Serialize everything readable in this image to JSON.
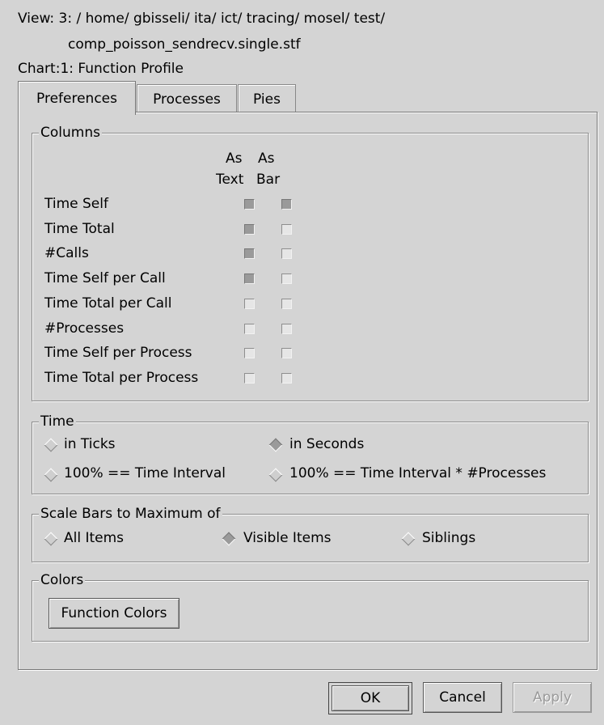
{
  "header": {
    "view_line1": "View: 3: / home/ gbisseli/ ita/ ict/ tracing/ mosel/ test/",
    "view_line2": "comp_poisson_sendrecv.single.stf",
    "chart_line": "Chart:1: Function Profile"
  },
  "tabs": [
    {
      "label": "Preferences",
      "active": true
    },
    {
      "label": "Processes",
      "active": false
    },
    {
      "label": "Pies",
      "active": false
    }
  ],
  "columns": {
    "legend": "Columns",
    "header_text_1": "As",
    "header_text_2": "Text",
    "header_bar_1": "As",
    "header_bar_2": "Bar",
    "rows": [
      {
        "label": "Time Self",
        "as_text": true,
        "as_bar": true
      },
      {
        "label": "Time Total",
        "as_text": true,
        "as_bar": false
      },
      {
        "label": "#Calls",
        "as_text": true,
        "as_bar": false
      },
      {
        "label": "Time Self per Call",
        "as_text": true,
        "as_bar": false
      },
      {
        "label": "Time Total per Call",
        "as_text": false,
        "as_bar": false
      },
      {
        "label": "#Processes",
        "as_text": false,
        "as_bar": false
      },
      {
        "label": "Time Self per Process",
        "as_text": false,
        "as_bar": false
      },
      {
        "label": "Time Total per Process",
        "as_text": false,
        "as_bar": false
      }
    ]
  },
  "time": {
    "legend": "Time",
    "in_ticks": "in Ticks",
    "in_seconds": "in Seconds",
    "pct_interval": "100% == Time Interval",
    "pct_interval_procs": "100% == Time Interval * #Processes",
    "selected_unit": "in Seconds"
  },
  "scale": {
    "legend": "Scale Bars to Maximum of",
    "all_items": "All Items",
    "visible_items": "Visible Items",
    "siblings": "Siblings",
    "selected": "Visible Items"
  },
  "colors": {
    "legend": "Colors",
    "function_colors_button": "Function Colors"
  },
  "buttons": {
    "ok": "OK",
    "cancel": "Cancel",
    "apply": "Apply"
  }
}
